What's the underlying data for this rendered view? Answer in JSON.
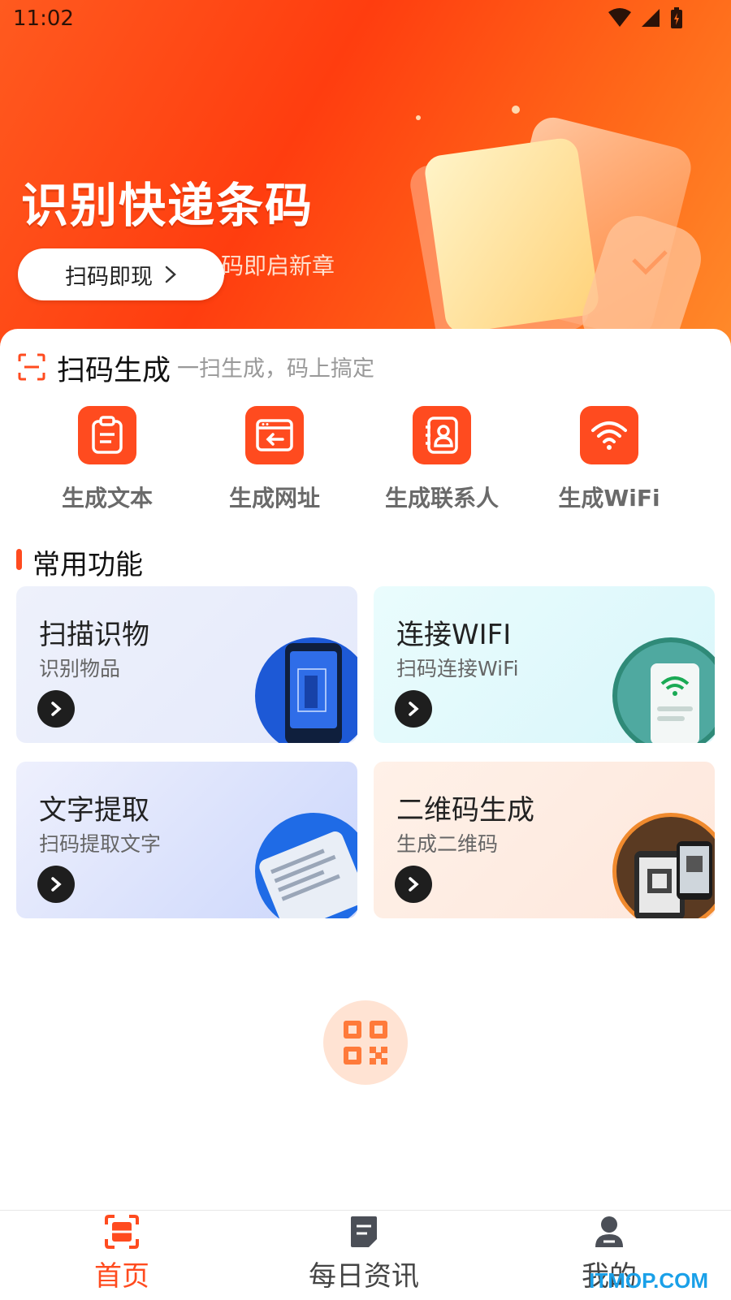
{
  "status_bar": {
    "time": "11:02"
  },
  "banner": {
    "title": "识别快递条码",
    "subtitle": "码即启新章",
    "button_label": "扫码即现"
  },
  "scan_generate": {
    "title": "扫码生成",
    "description": "一扫生成，码上搞定",
    "items": [
      {
        "label": "生成文本",
        "icon": "clipboard-icon"
      },
      {
        "label": "生成网址",
        "icon": "browser-icon"
      },
      {
        "label": "生成联系人",
        "icon": "contact-icon"
      },
      {
        "label": "生成WiFi",
        "icon": "wifi-icon"
      }
    ]
  },
  "common_functions": {
    "title": "常用功能",
    "cards": [
      {
        "title": "扫描识物",
        "subtitle": "识别物品"
      },
      {
        "title": "连接WIFI",
        "subtitle": "扫码连接WiFi"
      },
      {
        "title": "文字提取",
        "subtitle": "扫码提取文字"
      },
      {
        "title": "二维码生成",
        "subtitle": "生成二维码"
      }
    ]
  },
  "bottom_nav": [
    {
      "label": "首页",
      "active": true
    },
    {
      "label": "每日资讯",
      "active": false
    },
    {
      "label": "我的",
      "active": false
    }
  ],
  "watermark": "ITMOP.COM",
  "colors": {
    "accent": "#ff4b1f",
    "hero_start": "#ff5a1f",
    "hero_end": "#ff8a2a"
  }
}
